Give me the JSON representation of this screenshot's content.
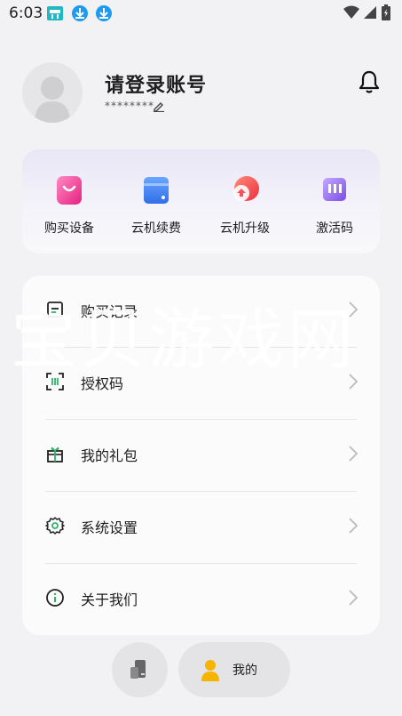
{
  "status_bar": {
    "time": "6:03"
  },
  "profile": {
    "title": "请登录账号",
    "masked_account": "********"
  },
  "quick_actions": [
    {
      "label": "购买设备",
      "icon": "shopping-bag-icon",
      "color": "#ee3a8f"
    },
    {
      "label": "云机续费",
      "icon": "wallet-icon",
      "color": "#3a7bef"
    },
    {
      "label": "云机升级",
      "icon": "upgrade-icon",
      "color": "#f2504b"
    },
    {
      "label": "激活码",
      "icon": "activation-code-icon",
      "color": "#9a6ff0"
    }
  ],
  "menu": [
    {
      "label": "购买记录",
      "icon": "purchase-record-icon"
    },
    {
      "label": "授权码",
      "icon": "scan-code-icon"
    },
    {
      "label": "我的礼包",
      "icon": "gift-icon"
    },
    {
      "label": "系统设置",
      "icon": "settings-icon"
    },
    {
      "label": "关于我们",
      "icon": "info-icon"
    }
  ],
  "watermark": "宝贝游戏网",
  "bottom_nav": {
    "mine_label": "我的"
  }
}
